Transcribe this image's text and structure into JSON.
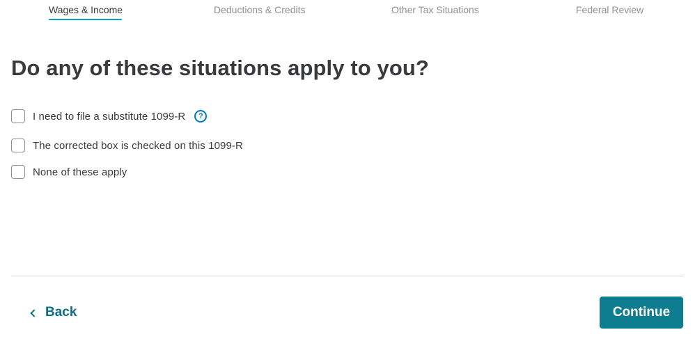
{
  "progress": {
    "steps": [
      {
        "label": "Wages & Income",
        "active": true
      },
      {
        "label": "Deductions & Credits",
        "active": false
      },
      {
        "label": "Other Tax Situations",
        "active": false
      },
      {
        "label": "Federal Review",
        "active": false
      }
    ]
  },
  "main": {
    "title": "Do any of these situations apply to you?",
    "options": [
      {
        "label": "I need to file a substitute 1099-R",
        "checked": false,
        "has_help": true
      },
      {
        "label": "The corrected box is checked on this 1099-R",
        "checked": false,
        "has_help": false
      },
      {
        "label": "None of these apply",
        "checked": false,
        "has_help": false
      }
    ],
    "help_icon_glyph": "?"
  },
  "footer": {
    "back_label": "Back",
    "continue_label": "Continue"
  },
  "colors": {
    "accent_underline": "#0d9bc9",
    "primary_button": "#0d7d8f",
    "link": "#0d6e85",
    "help_icon": "#0077c5"
  }
}
